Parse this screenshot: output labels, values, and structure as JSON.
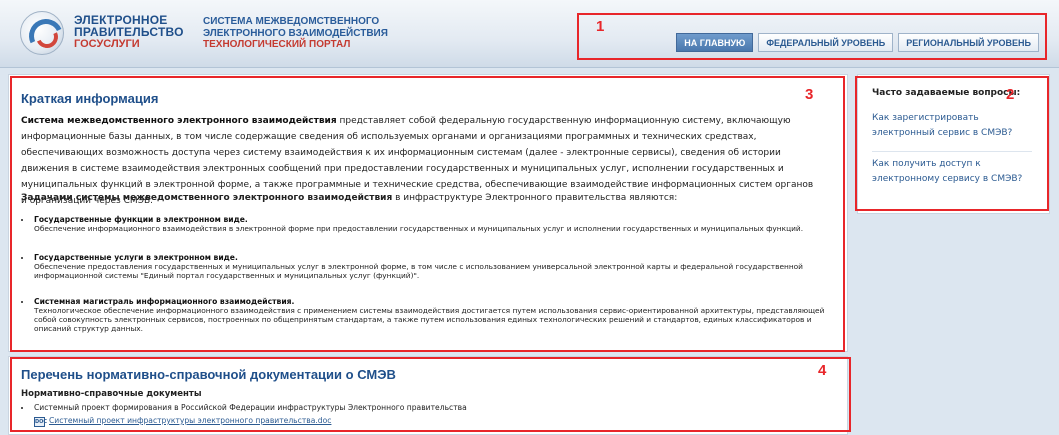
{
  "header": {
    "logo": {
      "line1": "ЭЛЕКТРОННОЕ",
      "line2": "ПРАВИТЕЛЬСТВО",
      "line3": "ГОСУСЛУГИ"
    },
    "system": {
      "line1": "СИСТЕМА МЕЖВЕДОМСТВЕННОГО",
      "line2": "ЭЛЕКТРОННОГО ВЗАИМОДЕЙСТВИЯ",
      "line3": "ТЕХНОЛОГИЧЕСКИЙ ПОРТАЛ"
    },
    "nav": {
      "home": "НА ГЛАВНУЮ",
      "federal": "ФЕДЕРАЛЬНЫЙ УРОВЕНЬ",
      "regional": "РЕГИОНАЛЬНЫЙ УРОВЕНЬ"
    }
  },
  "annotations": {
    "n1": "1",
    "n2": "2",
    "n3": "3",
    "n4": "4"
  },
  "info": {
    "title": "Краткая информация",
    "intro_bold": "Система межведомственного электронного взаимодействия",
    "intro_text": " представляет собой федеральную государственную информационную систему, включающую информационные базы данных, в том числе содержащие сведения об используемых органами и организациями программных и технических средствах, обеспечивающих возможность доступа через систему взаимодействия к их информационным системам (далее - электронные сервисы), сведения об истории движения в системе взаимодействия электронных сообщений при предоставлении государственных и муниципальных услуг, исполнении государственных и муниципальных функций в электронной форме, а также программные и технические средства, обеспечивающие взаимодействие информационных систем органов и организаций через СМЭВ.",
    "tasks_bold": "Задачами системы межведомственного электронного взаимодействия",
    "tasks_text": " в инфраструктуре Электронного правительства являются:",
    "items": [
      {
        "title": "Государственные функции в электронном виде.",
        "desc": "Обеспечение информационного взаимодействия в электронной форме при предоставлении государственных и муниципальных услуг и исполнении государственных и муниципальных функций."
      },
      {
        "title": "Государственные услуги в электронном виде.",
        "desc": "Обеспечение предоставления государственных и муниципальных услуг в электронной форме, в том числе с использованием универсальной электронной карты и федеральной государственной информационной системы \"Единый портал государственных и муниципальных услуг (функций)\"."
      },
      {
        "title": "Системная магистраль информационного взаимодействия.",
        "desc": "Технологическое обеспечение информационного взаимодействия с применением системы взаимодействия достигается путем использования сервис-ориентированной архитектуры, представляющей собой совокупность электронных сервисов, построенных по общепринятым стандартам, а также путем использования единых технологических решений и стандартов, единых классификаторов и описаний структур данных."
      }
    ]
  },
  "faq": {
    "title": "Часто задаваемые вопросы:",
    "links": [
      "Как зарегистрировать электронный сервис в СМЭВ?",
      "Как получить доступ к электронному сервису в СМЭВ?"
    ]
  },
  "docs": {
    "title": "Перечень нормативно-справочной документации о СМЭВ",
    "subtitle": "Нормативно-справочные документы",
    "doc_title": "Системный проект формирования в Российской Федерации инфраструктуры Электронного правительства",
    "icon_label": "DOC",
    "doc_link": "Системный проект инфраструктуры электронного правительства.doc"
  }
}
